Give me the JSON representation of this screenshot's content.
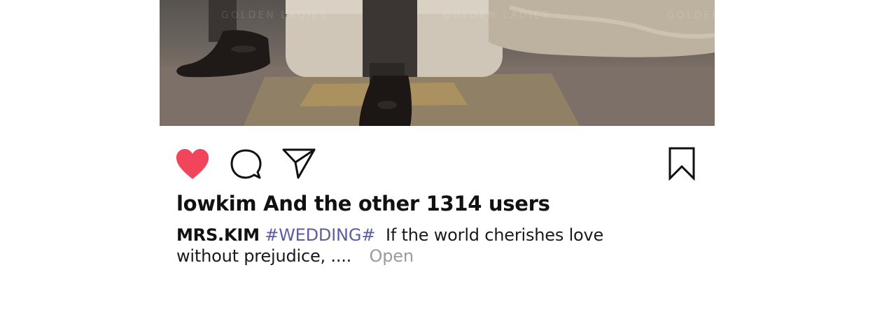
{
  "photo": {
    "alt_watermarks": [
      "GOLDEN LADIES",
      "GOLDEN LADIES",
      "GOLDEN"
    ]
  },
  "actions": {
    "like_icon": "heart-filled-icon",
    "comment_icon": "speech-bubble-icon",
    "share_icon": "paper-plane-icon",
    "save_icon": "bookmark-icon",
    "like_color": "#f2455c"
  },
  "likes": {
    "text": "lowkim And the other 1314 users"
  },
  "caption": {
    "username": "MRS.KIM",
    "hashtag": "#WEDDING#",
    "text": "If the world cherishes love without prejudice, ....",
    "more_label": "Open"
  }
}
